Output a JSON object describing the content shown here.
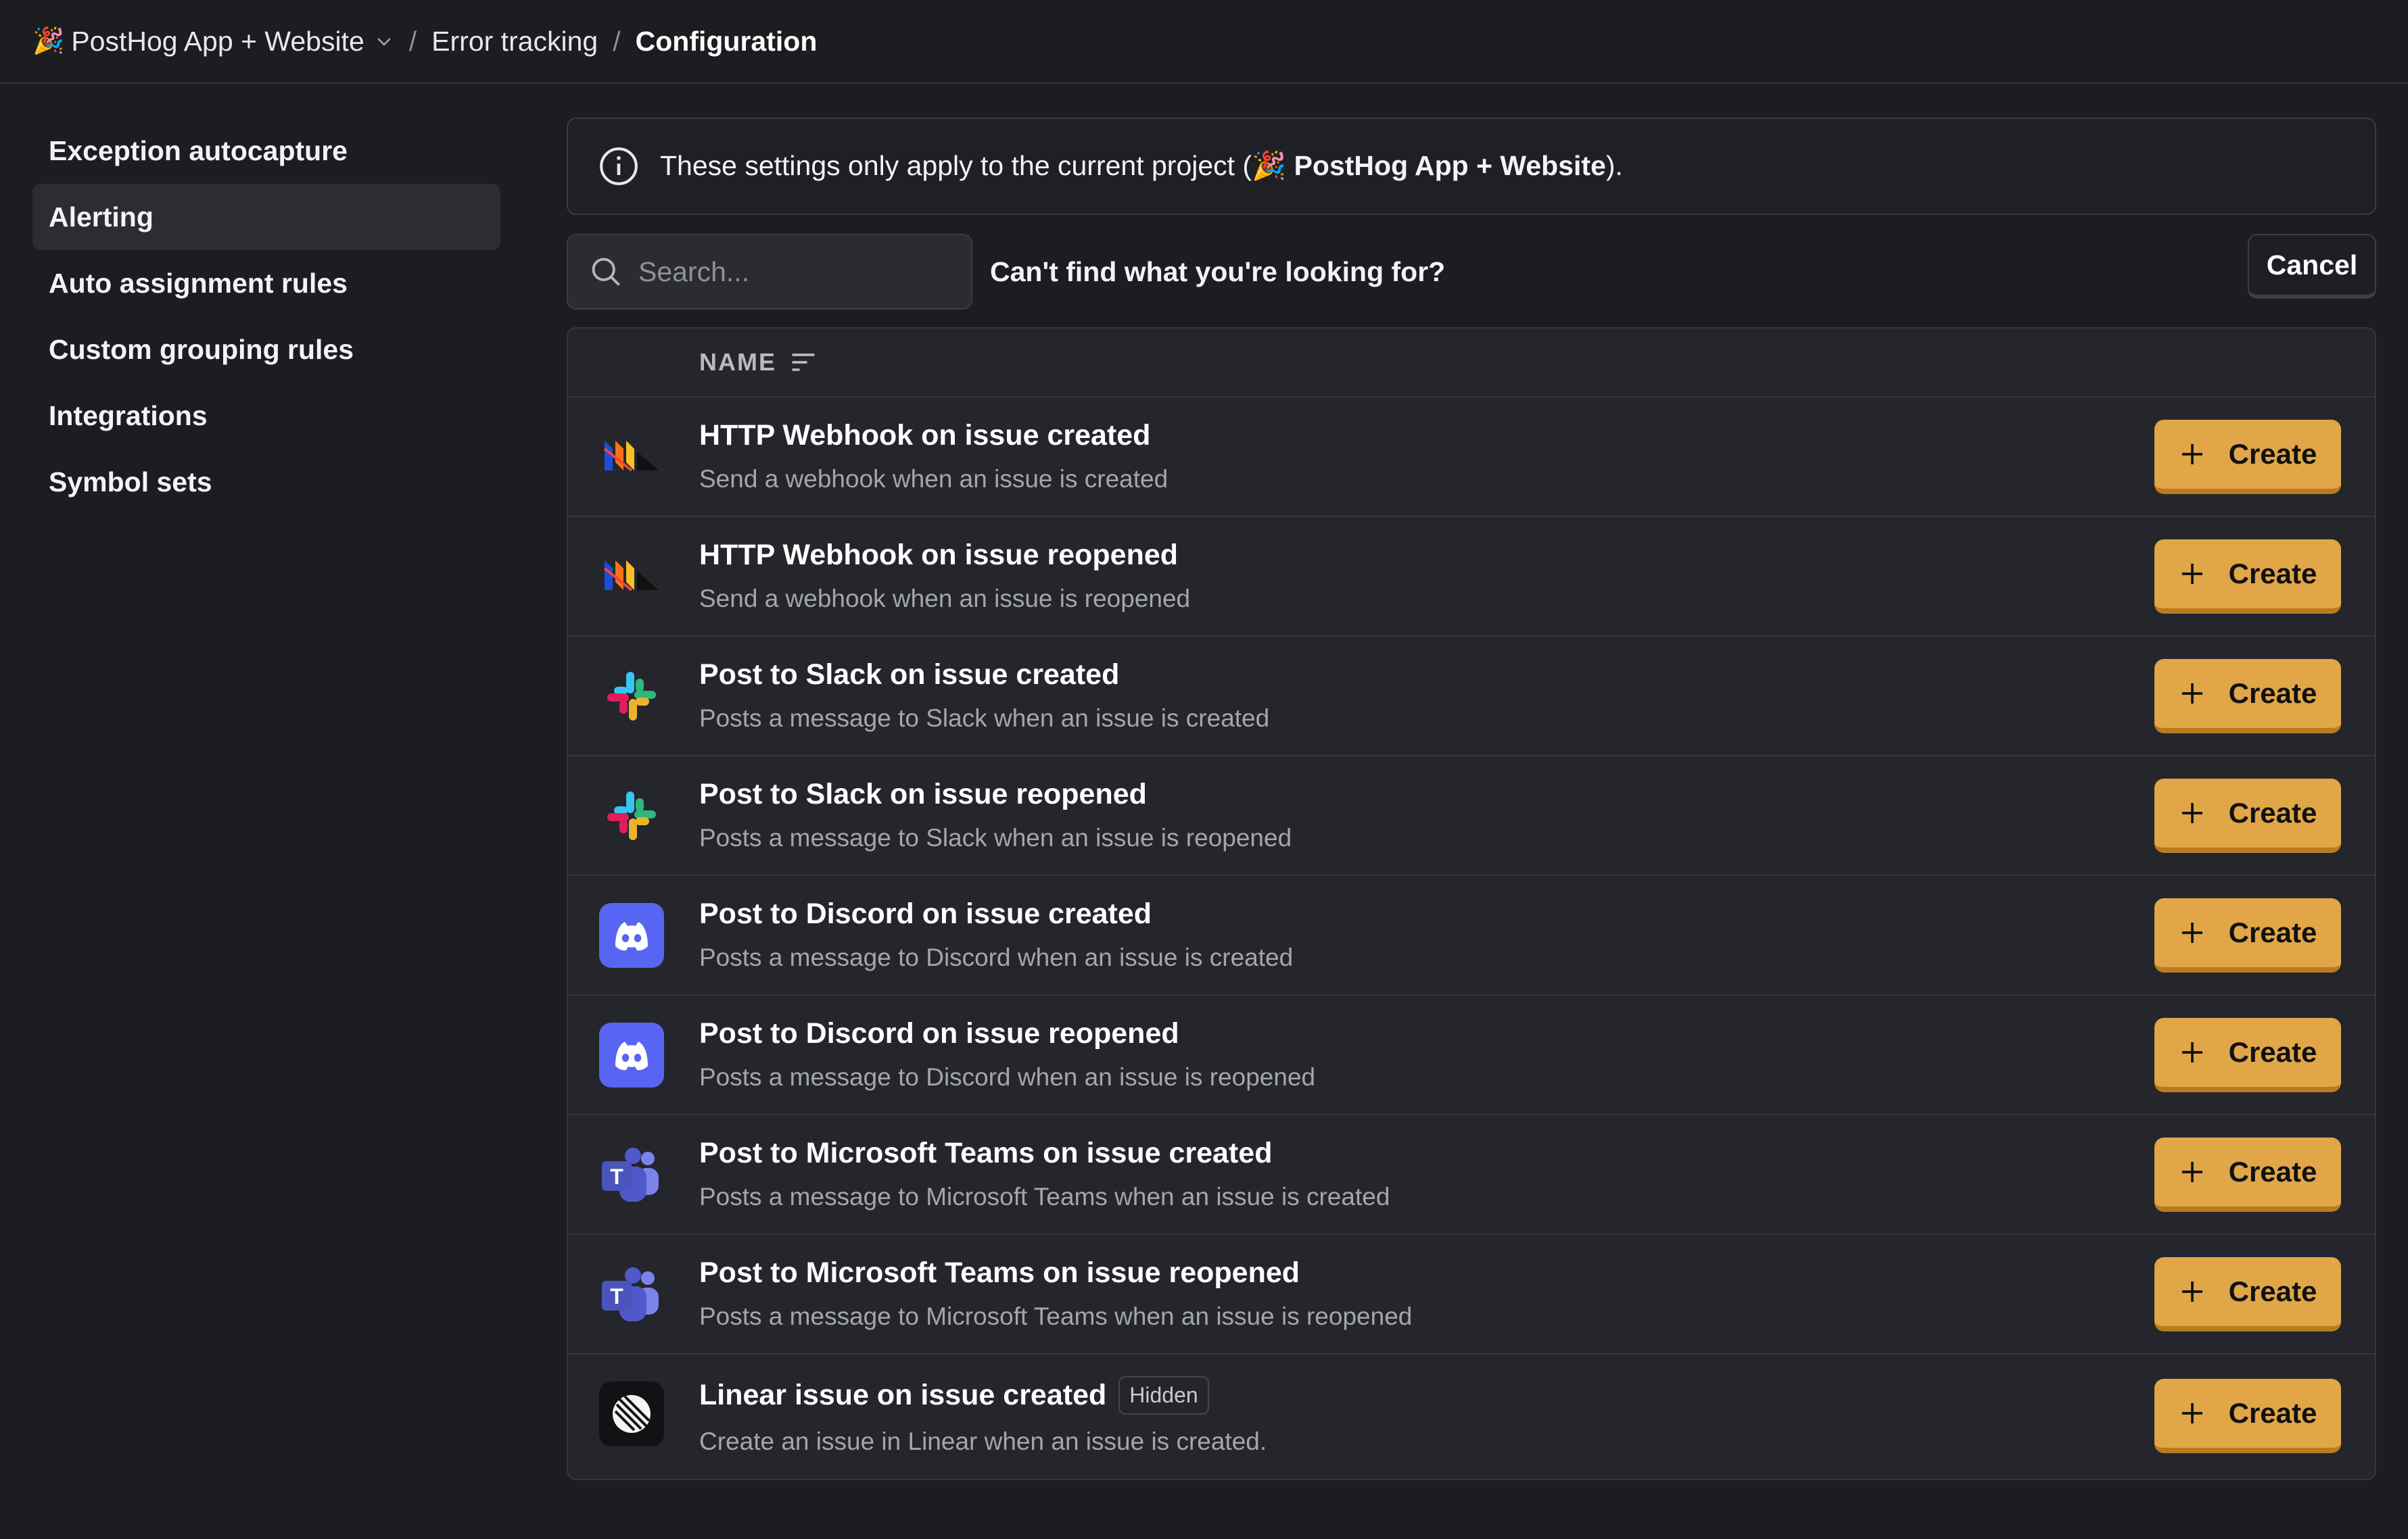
{
  "breadcrumb": {
    "project_emoji": "🎉",
    "project": "PostHog App + Website",
    "section": "Error tracking",
    "current": "Configuration"
  },
  "sidebar": {
    "items": [
      {
        "label": "Exception autocapture"
      },
      {
        "label": "Alerting",
        "active": true
      },
      {
        "label": "Auto assignment rules"
      },
      {
        "label": "Custom grouping rules"
      },
      {
        "label": "Integrations"
      },
      {
        "label": "Symbol sets"
      }
    ]
  },
  "notice": {
    "prefix": "These settings only apply to the current project (",
    "project_emoji": "🎉",
    "project": " PostHog App + Website",
    "suffix": ")."
  },
  "search": {
    "placeholder": "Search..."
  },
  "help_text": "Can't find what you're looking for?",
  "cancel_label": "Cancel",
  "table": {
    "column_name": "NAME",
    "create_label": "Create",
    "rows": [
      {
        "icon": "webhook-icon",
        "title": "HTTP Webhook on issue created",
        "desc": "Send a webhook when an issue is created"
      },
      {
        "icon": "webhook-icon",
        "title": "HTTP Webhook on issue reopened",
        "desc": "Send a webhook when an issue is reopened"
      },
      {
        "icon": "slack-icon",
        "title": "Post to Slack on issue created",
        "desc": "Posts a message to Slack when an issue is created"
      },
      {
        "icon": "slack-icon",
        "title": "Post to Slack on issue reopened",
        "desc": "Posts a message to Slack when an issue is reopened"
      },
      {
        "icon": "discord-icon",
        "title": "Post to Discord on issue created",
        "desc": "Posts a message to Discord when an issue is created"
      },
      {
        "icon": "discord-icon",
        "title": "Post to Discord on issue reopened",
        "desc": "Posts a message to Discord when an issue is reopened"
      },
      {
        "icon": "teams-icon",
        "title": "Post to Microsoft Teams on issue created",
        "desc": "Posts a message to Microsoft Teams when an issue is created"
      },
      {
        "icon": "teams-icon",
        "title": "Post to Microsoft Teams on issue reopened",
        "desc": "Posts a message to Microsoft Teams when an issue is reopened"
      },
      {
        "icon": "linear-icon",
        "title": "Linear issue on issue created",
        "badge": "Hidden",
        "desc": "Create an issue in Linear when an issue is created."
      }
    ]
  },
  "colors": {
    "background": "#1c1d21",
    "create_button": "#e0a648",
    "discord": "#5865f2",
    "teams": "#5059c9"
  }
}
